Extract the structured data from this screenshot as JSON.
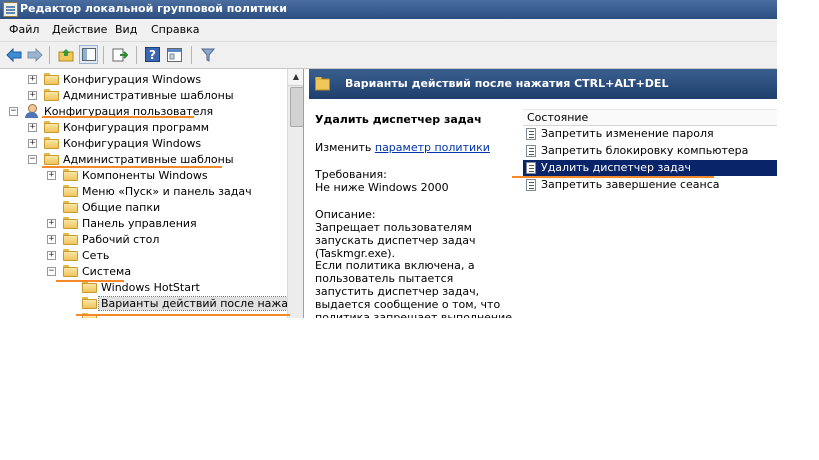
{
  "window": {
    "title": "Редактор локальной групповой политики"
  },
  "menu": [
    "Файл",
    "Действие",
    "Вид",
    "Справка"
  ],
  "toolbar": {
    "buttons": [
      "back-arrow-icon",
      "forward-arrow-icon",
      "up-folder-icon",
      "show-hide-tree-icon",
      "export-list-icon",
      "help-icon",
      "properties-icon",
      "filter-icon"
    ]
  },
  "tree": {
    "items": [
      {
        "label": "Конфигурация Windows",
        "expander": "+"
      },
      {
        "label": "Административные шаблоны",
        "expander": "+"
      },
      {
        "label": "Конфигурация пользователя",
        "expander": "−"
      },
      {
        "label": "Конфигурация программ",
        "expander": "+"
      },
      {
        "label": "Конфигурация Windows",
        "expander": "+"
      },
      {
        "label": "Административные шаблоны",
        "expander": "−"
      },
      {
        "label": "Компоненты Windows",
        "expander": "+"
      },
      {
        "label": "Меню «Пуск» и панель задач",
        "expander": ""
      },
      {
        "label": "Общие папки",
        "expander": ""
      },
      {
        "label": "Панель управления",
        "expander": "+"
      },
      {
        "label": "Рабочий стол",
        "expander": "+"
      },
      {
        "label": "Сеть",
        "expander": "+"
      },
      {
        "label": "Система",
        "expander": "−"
      },
      {
        "label": "Windows HotStart",
        "expander": ""
      },
      {
        "label": "Варианты действий после нажатия CTRL+ALT+DEL",
        "expander": ""
      }
    ]
  },
  "details": {
    "header_title": "Варианты действий после нажатия CTRL+ALT+DEL",
    "policy_name": "Удалить диспетчер задач",
    "edit_prefix": "Изменить",
    "edit_link": "параметр политики",
    "requirements_label": "Требования:",
    "requirements_value": "Не ниже Windows 2000",
    "description_label": "Описание:",
    "description_p1": "Запрещает пользователям запускать диспетчер задач (Taskmgr.exe).",
    "description_p2": "Если политика включена, а пользователь пытается запустить диспетчер задач, выдается сообщение о том, что политика запрещает выполнение данного"
  },
  "list": {
    "column_header": "Состояние",
    "rows": [
      {
        "label": "Запретить изменение пароля",
        "selected": false
      },
      {
        "label": "Запретить блокировку компьютера",
        "selected": false
      },
      {
        "label": "Удалить диспетчер задач",
        "selected": true
      },
      {
        "label": "Запретить завершение сеанса",
        "selected": false
      }
    ]
  },
  "colors": {
    "annotation": "#f4892a",
    "selection": "#0a246a",
    "header_band": "#2c4e80"
  }
}
